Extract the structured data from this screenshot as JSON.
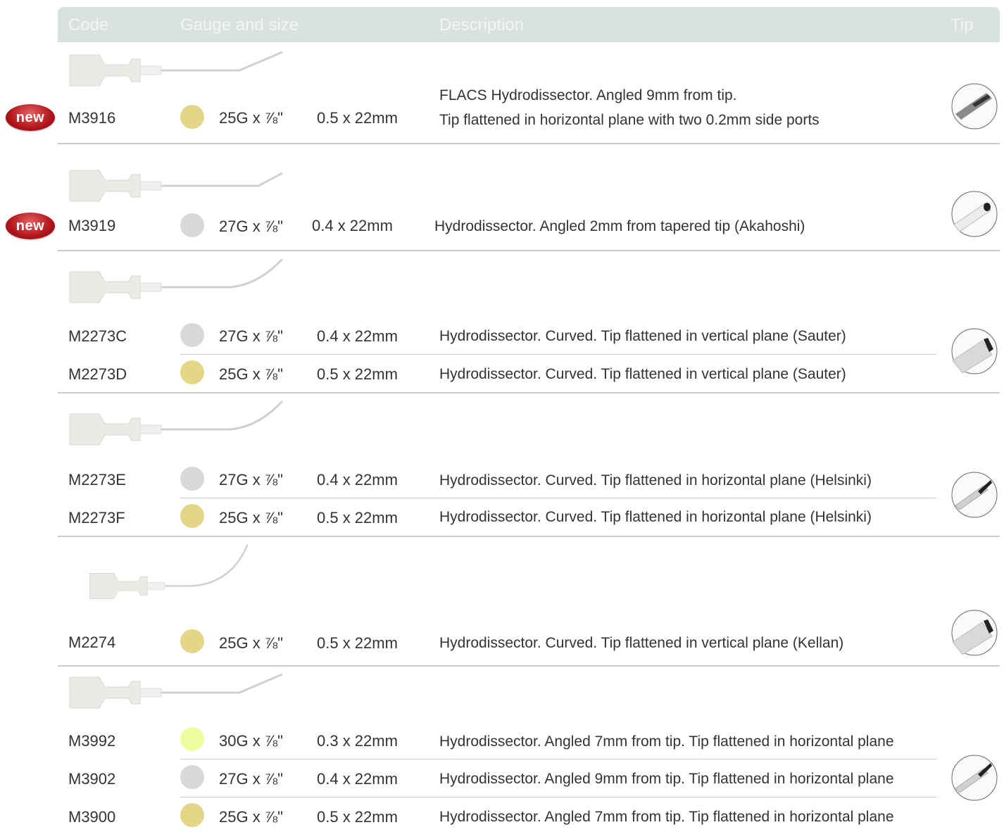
{
  "header": {
    "code": "Code",
    "gauge": "Gauge and size",
    "description": "Description",
    "tip": "Tip"
  },
  "badge_label": "new",
  "colors": {
    "yellow": "#e5d589",
    "grey": "#d8d8d8",
    "lime": "#eefda0",
    "header_bg": "#d9e2dc",
    "badge_red": "#b3141c"
  },
  "rows": [
    {
      "code": "M3916",
      "gauge": "25G x ⅞\"",
      "size": "0.5 x 22mm",
      "desc1": "FLACS Hydrodissector. Angled 9mm from tip.",
      "desc2": "Tip flattened in horizontal plane with two 0.2mm side ports"
    },
    {
      "code": "M3919",
      "gauge": "27G x  ⅞\"",
      "size": "0.4 x 22mm",
      "desc1": "Hydrodissector. Angled 2mm from tapered tip (Akahoshi)"
    },
    {
      "code": "M2273C",
      "gauge": "27G x ⅞\"",
      "size": "0.4 x 22mm",
      "desc1": "Hydrodissector. Curved. Tip flattened in vertical plane (Sauter)"
    },
    {
      "code": "M2273D",
      "gauge": "25G x ⅞\"",
      "size": "0.5 x 22mm",
      "desc1": "Hydrodissector. Curved. Tip flattened in vertical plane (Sauter)"
    },
    {
      "code": "M2273E",
      "gauge": "27G x ⅞\"",
      "size": "0.4 x 22mm",
      "desc1": "Hydrodissector. Curved. Tip flattened in horizontal plane (Helsinki)"
    },
    {
      "code": "M2273F",
      "gauge": "25G x ⅞\"",
      "size": "0.5 x 22mm",
      "desc1": "Hydrodissector. Curved. Tip flattened in horizontal plane (Helsinki)"
    },
    {
      "code": "M2274",
      "gauge": "25G x ⅞\"",
      "size": "0.5 x 22mm",
      "desc1": "Hydrodissector. Curved. Tip flattened in vertical plane (Kellan)"
    },
    {
      "code": "M3992",
      "gauge": "30G x ⅞\"",
      "size": "0.3 x 22mm",
      "desc1": "Hydrodissector. Angled 7mm from tip. Tip flattened in horizontal plane"
    },
    {
      "code": "M3902",
      "gauge": "27G x ⅞\"",
      "size": "0.4 x 22mm",
      "desc1": "Hydrodissector. Angled 9mm from tip. Tip flattened in horizontal plane"
    },
    {
      "code": "M3900",
      "gauge": "25G x ⅞\"",
      "size": "0.5 x 22mm",
      "desc1": "Hydrodissector. Angled 7mm from tip. Tip flattened in horizontal plane"
    }
  ]
}
